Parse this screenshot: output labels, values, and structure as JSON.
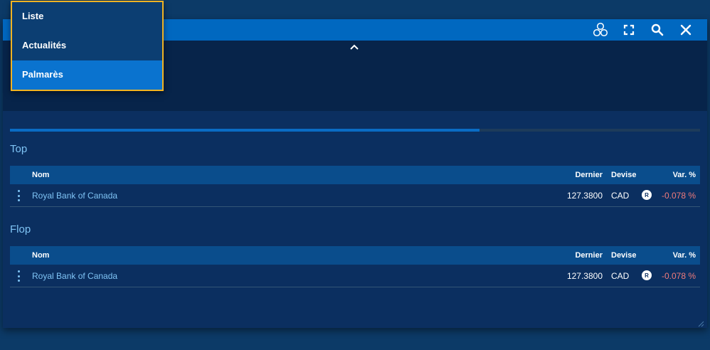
{
  "menu": {
    "items": [
      {
        "label": "Liste"
      },
      {
        "label": "Actualités"
      },
      {
        "label": "Palmarès"
      }
    ],
    "selected": "Palmarès"
  },
  "toolbar": {
    "icons": [
      "circles-icon",
      "expand-icon",
      "search-icon",
      "close-icon"
    ]
  },
  "progress": {
    "fraction": 0.68
  },
  "columns": {
    "name": "Nom",
    "last": "Dernier",
    "currency": "Devise",
    "change": "Var. %"
  },
  "top": {
    "title": "Top",
    "rows": [
      {
        "name": "Royal Bank of Canada",
        "last": "127.3800",
        "currency": "CAD",
        "badge": "R",
        "change": "-0.078 %"
      }
    ]
  },
  "flop": {
    "title": "Flop",
    "rows": [
      {
        "name": "Royal Bank of Canada",
        "last": "127.3800",
        "currency": "CAD",
        "badge": "R",
        "change": "-0.078 %"
      }
    ]
  },
  "colors": {
    "accent": "#0068c0",
    "highlight": "#f0b323",
    "negative": "#f07b7b",
    "link": "#7fc4f5"
  }
}
